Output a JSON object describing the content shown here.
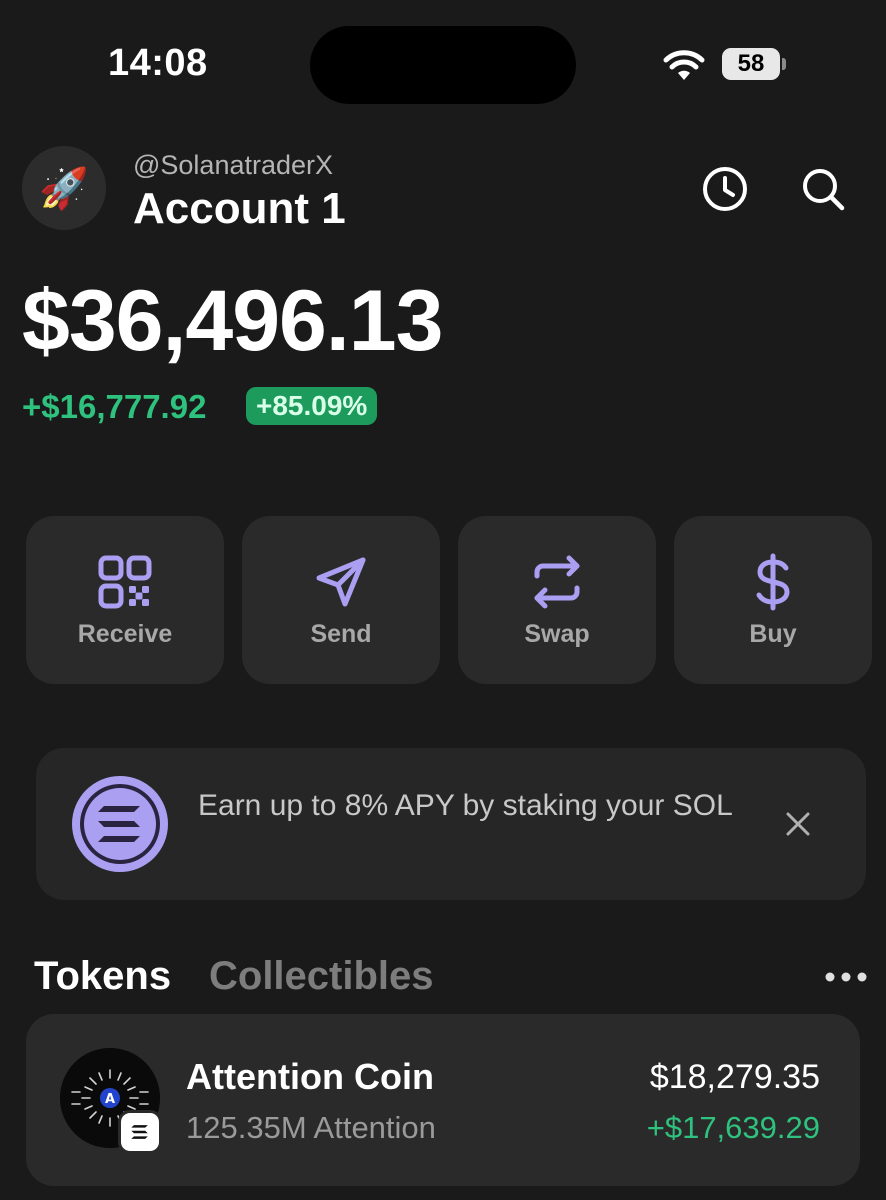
{
  "status_bar": {
    "time": "14:08",
    "battery": "58",
    "icons": [
      "wifi-icon",
      "battery-icon"
    ]
  },
  "header": {
    "avatar_icon": "rocket-icon",
    "username": "@SolanatraderX",
    "account_name": "Account 1",
    "icons": [
      "history-clock-icon",
      "search-icon"
    ]
  },
  "balance": {
    "total": "$36,496.13",
    "change_amount": "+$16,777.92",
    "change_percent": "+85.09%"
  },
  "actions": [
    {
      "label": "Receive",
      "icon": "qr-code-icon"
    },
    {
      "label": "Send",
      "icon": "send-arrow-icon"
    },
    {
      "label": "Swap",
      "icon": "swap-arrows-icon"
    },
    {
      "label": "Buy",
      "icon": "dollar-icon"
    }
  ],
  "banner": {
    "text": "Earn up to 8% APY by staking your SOL",
    "icon": "solana-logo-icon"
  },
  "tabs": {
    "tokens": "Tokens",
    "collectibles": "Collectibles"
  },
  "tokens": [
    {
      "name": "Attention Coin",
      "amount": "125.35M Attention",
      "value": "$18,279.35",
      "change": "+$17,639.29"
    }
  ],
  "colors": {
    "background": "#1a1a1a",
    "card": "#2a2a2a",
    "accent_purple": "#ab9ff2",
    "positive_green": "#2ec27e"
  }
}
